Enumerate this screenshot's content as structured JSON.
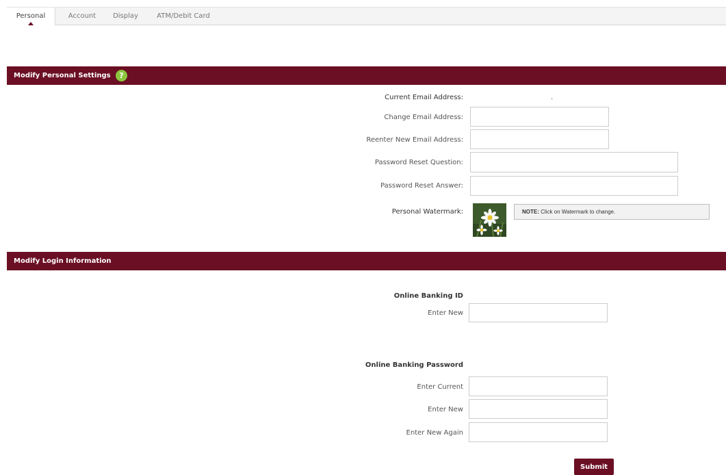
{
  "tabs": [
    {
      "label": "Personal",
      "active": true
    },
    {
      "label": "Account",
      "active": false
    },
    {
      "label": "Display",
      "active": false
    },
    {
      "label": "ATM/Debit Card",
      "active": false
    }
  ],
  "personal_section": {
    "title": "Modify Personal Settings",
    "help_icon": "?",
    "current_email_label": "Current Email Address:",
    "current_email_value": ".",
    "change_email_label": "Change Email Address:",
    "change_email_value": "",
    "reenter_email_label": "Reenter New Email Address:",
    "reenter_email_value": "",
    "reset_question_label": "Password Reset Question:",
    "reset_question_value": "",
    "reset_answer_label": "Password Reset Answer:",
    "reset_answer_value": "",
    "watermark_label": "Personal Watermark:",
    "watermark_icon": "daisy-flower-image",
    "note_prefix": "NOTE:",
    "note_text": " Click on Watermark to change."
  },
  "login_section": {
    "title": "Modify Login Information",
    "banking_id_heading": "Online Banking ID",
    "id_enter_new_label": "Enter New",
    "id_enter_new_value": "",
    "banking_password_heading": "Online Banking Password",
    "pw_enter_current_label": "Enter Current",
    "pw_enter_current_value": "",
    "pw_enter_new_label": "Enter New",
    "pw_enter_new_value": "",
    "pw_enter_new_again_label": "Enter New Again",
    "pw_enter_new_again_value": "",
    "submit_label": "Submit"
  },
  "colors": {
    "brand": "#6b0f24",
    "help": "#8cc63f"
  }
}
